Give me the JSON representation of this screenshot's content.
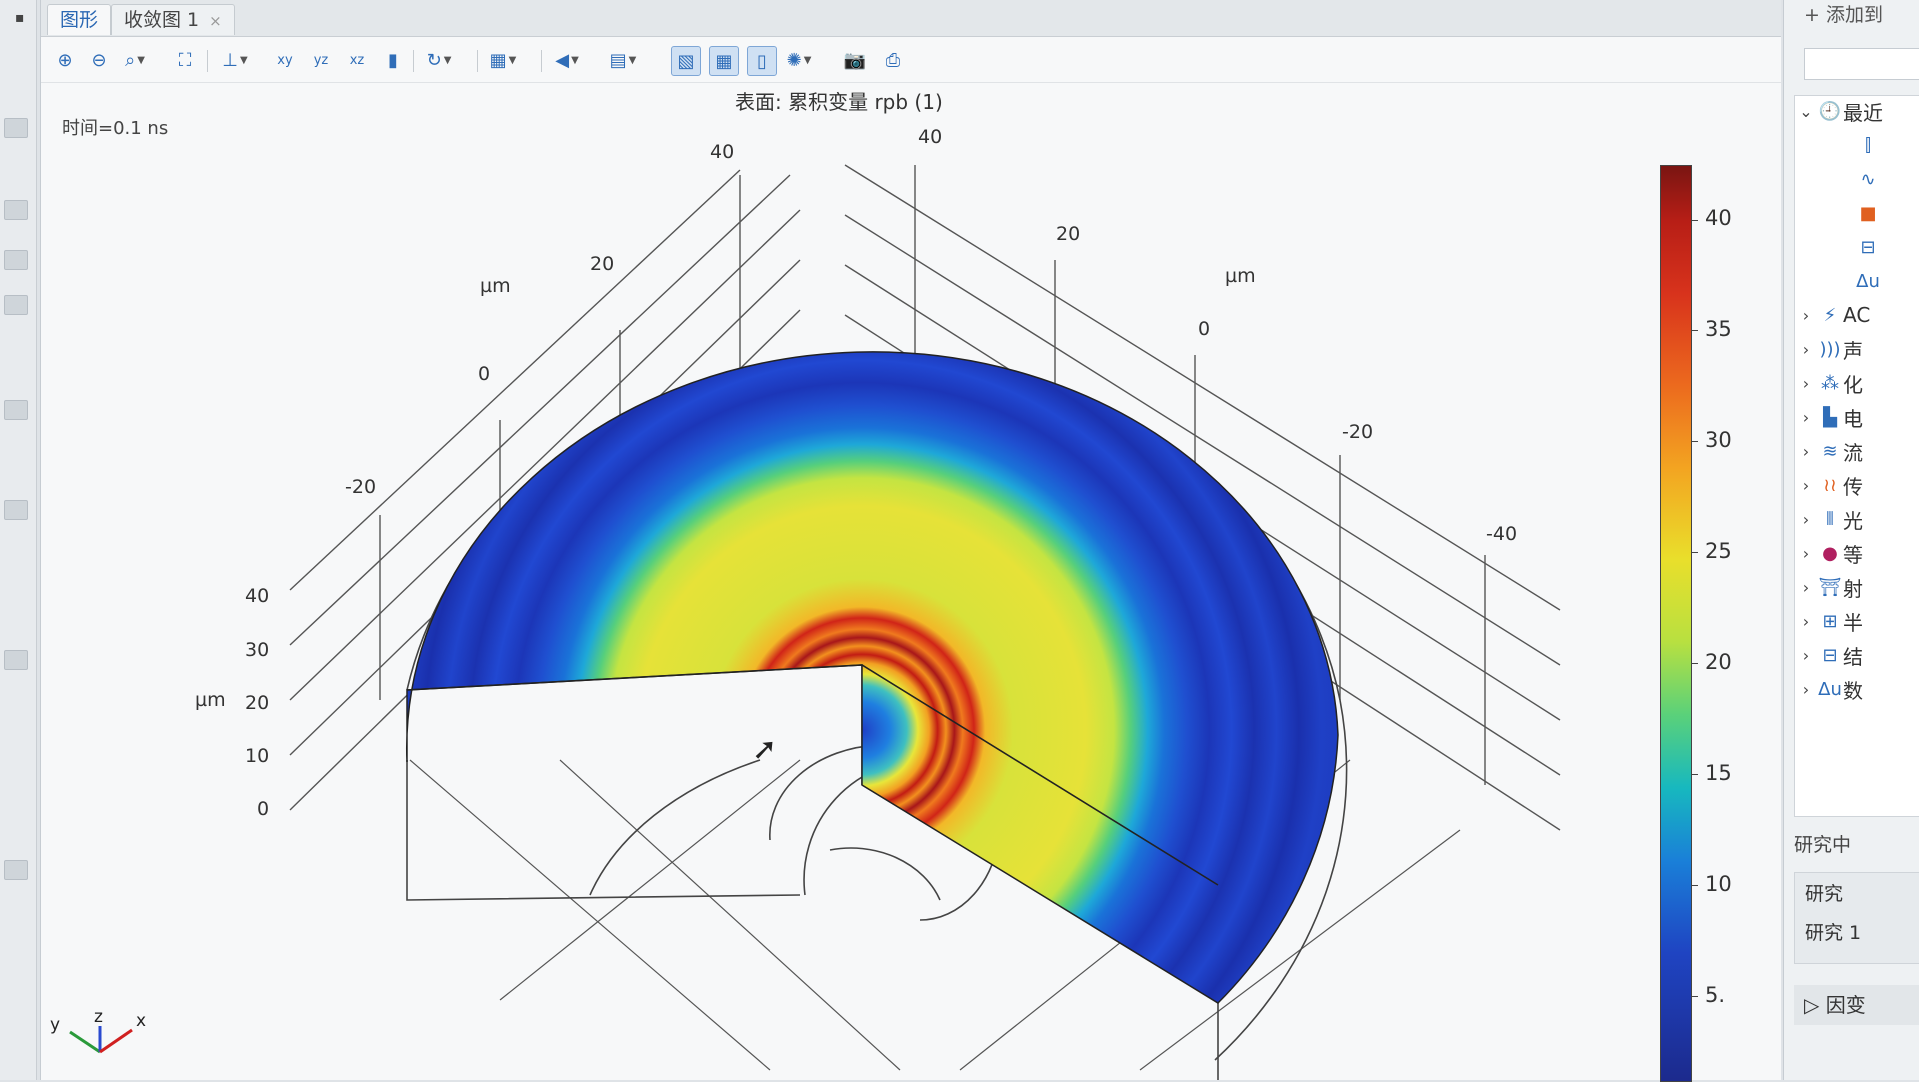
{
  "tabs": {
    "graphics": "图形",
    "convergence": "收敛图 1",
    "close": "×"
  },
  "toolbar": {
    "icons": [
      "zoom-in-icon",
      "zoom-out-icon",
      "zoom-box-icon",
      "zoom-extents-icon",
      "axis-icon",
      "xy-view-icon",
      "yz-view-icon",
      "xz-view-icon",
      "bar-view-icon",
      "rotate-icon",
      "render-icon",
      "light-icon",
      "scene-icon",
      "grid-icon",
      "table-icon",
      "frame-icon",
      "refresh-icon",
      "camera-icon",
      "print-icon"
    ],
    "labels": {
      "xy": "xy",
      "yz": "yz",
      "xz": "xz"
    }
  },
  "plot": {
    "title": "表面: 累积变量 rpb (1)",
    "time": "时间=0.1 ns",
    "axis_unit": "µm",
    "left_ticks": [
      "40",
      "20",
      "0",
      "-20"
    ],
    "right_ticks": [
      "40",
      "20",
      "0",
      "-20",
      "-40"
    ],
    "z_ticks": [
      "40",
      "30",
      "20",
      "10",
      "0"
    ],
    "triad": {
      "y": "y",
      "z": "z",
      "x": "x"
    }
  },
  "colorbar": {
    "labels": [
      "40",
      "35",
      "30",
      "25",
      "20",
      "15",
      "10",
      "5."
    ]
  },
  "right_panel": {
    "add_label": "+ 添加到",
    "recent": "最近",
    "tree_items": [
      "AC",
      "声",
      "化",
      "电",
      "流",
      "传",
      "光",
      "等",
      "射",
      "半",
      "结",
      "数"
    ],
    "delta_label": "Δu",
    "section_title": "研究中",
    "study": "研究",
    "study1": "研究 1",
    "bottom_item": "因变"
  }
}
